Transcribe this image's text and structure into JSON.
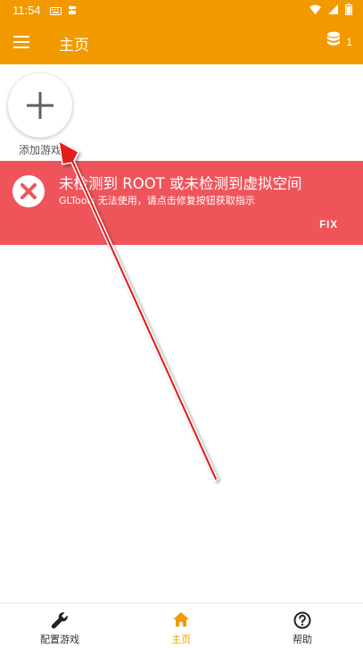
{
  "status_bar": {
    "time": "11:54",
    "icons": [
      "keyboard-icon",
      "app-notification-icon",
      "wifi-icon",
      "signal-icon",
      "battery-icon"
    ]
  },
  "app_bar": {
    "title": "主页",
    "coin_count": "1",
    "color": "#f29900"
  },
  "add_game": {
    "label": "添加游戏"
  },
  "error_banner": {
    "title": "未检测到 ROOT 或未检测到虚拟空间",
    "subtitle": "GLTools 无法使用，请点击修复按钮获取指示",
    "fix_label": "FIX",
    "color": "#f0545b"
  },
  "bottom_nav": {
    "items": [
      {
        "label": "配置游戏",
        "icon": "wrench-icon"
      },
      {
        "label": "主页",
        "icon": "home-icon",
        "active": true
      },
      {
        "label": "帮助",
        "icon": "help-icon"
      }
    ]
  }
}
